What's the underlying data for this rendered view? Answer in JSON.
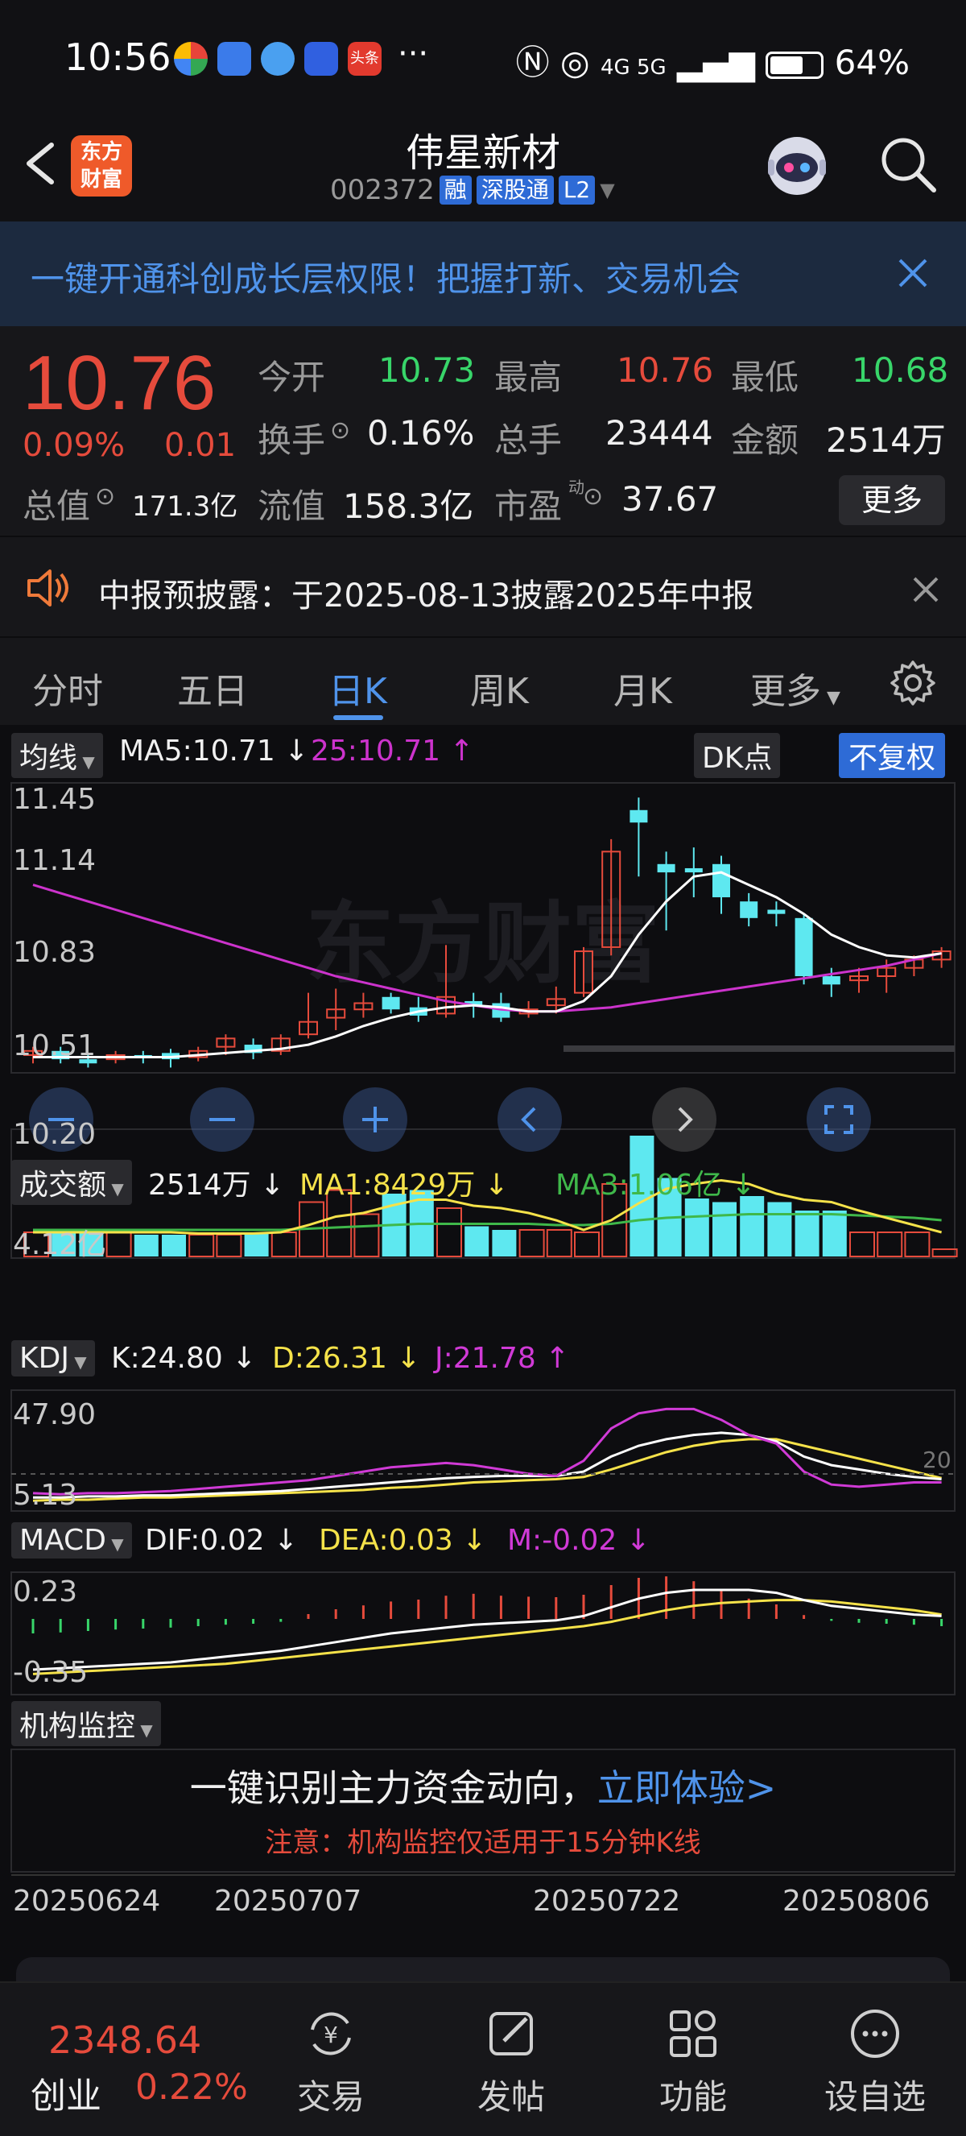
{
  "status_bar": {
    "time": "10:56",
    "battery": "64%",
    "network": "4G 5G"
  },
  "header": {
    "logo_text": "东方\n财富",
    "stock_name": "伟星新材",
    "stock_code": "002372",
    "tags": [
      "融",
      "深股通",
      "L2"
    ]
  },
  "promo_banner": {
    "text": "一键开通科创成长层权限！把握打新、交易机会"
  },
  "quote": {
    "price": "10.76",
    "change_pct": "0.09%",
    "change": "0.01",
    "open_label": "今开",
    "open": "10.73",
    "high_label": "最高",
    "high": "10.76",
    "low_label": "最低",
    "low": "10.68",
    "turnover_label": "换手",
    "turnover": "0.16%",
    "volume_label": "总手",
    "volume": "23444",
    "amount_label": "金额",
    "amount": "2514万",
    "mktcap_label": "总值",
    "mktcap": "171.3亿",
    "float_label": "流值",
    "float_cap": "158.3亿",
    "pe_label": "市盈",
    "pe_sup": "动",
    "pe": "37.67",
    "more_label": "更多"
  },
  "notice": {
    "text": "中报预披露：于2025-08-13披露2025年中报"
  },
  "tabs": [
    "分时",
    "五日",
    "日K",
    "周K",
    "月K",
    "更多"
  ],
  "active_tab": "日K",
  "chart": {
    "ma_chip": "均线",
    "ma5": "MA5:10.71",
    "ma25": "25:10.71",
    "dk_chip": "DK点",
    "fq_chip": "不复权",
    "price_ticks": [
      "11.45",
      "11.14",
      "10.83",
      "10.51",
      "10.20"
    ],
    "vol_chip": "成交额",
    "vol_val": "2514万",
    "vol_ma1": "MA1:8429万",
    "vol_ma3": "MA3:1.06亿",
    "vol_tick": "4.12亿",
    "kdj_chip": "KDJ",
    "kdj_k": "K:24.80",
    "kdj_d": "D:26.31",
    "kdj_j": "J:21.78",
    "kdj_ticks": [
      "47.90",
      "5.13"
    ],
    "kdj_right": "20",
    "macd_chip": "MACD",
    "macd_dif": "DIF:0.02",
    "macd_dea": "DEA:0.03",
    "macd_m": "M:-0.02",
    "macd_ticks": [
      "0.23",
      "-0.35"
    ],
    "monitor_chip": "机构监控",
    "monitor_main": "一键识别主力资金动向，",
    "monitor_link": "立即体验>",
    "monitor_note": "注意：机构监控仅适用于15分钟K线",
    "dates": [
      "20250624",
      "20250707",
      "20250722",
      "20250806"
    ],
    "watermark": "东方财富"
  },
  "colors": {
    "up": "#e64b3c",
    "down": "#5ee8f0",
    "ma5": "#ffffff",
    "ma25": "#cc33cc",
    "accent": "#4f93ea"
  },
  "bottom_nav": {
    "index_value": "2348.64",
    "index_name": "创业",
    "index_pct": "0.22%",
    "items": [
      "交易",
      "发帖",
      "功能",
      "设自选"
    ]
  }
}
